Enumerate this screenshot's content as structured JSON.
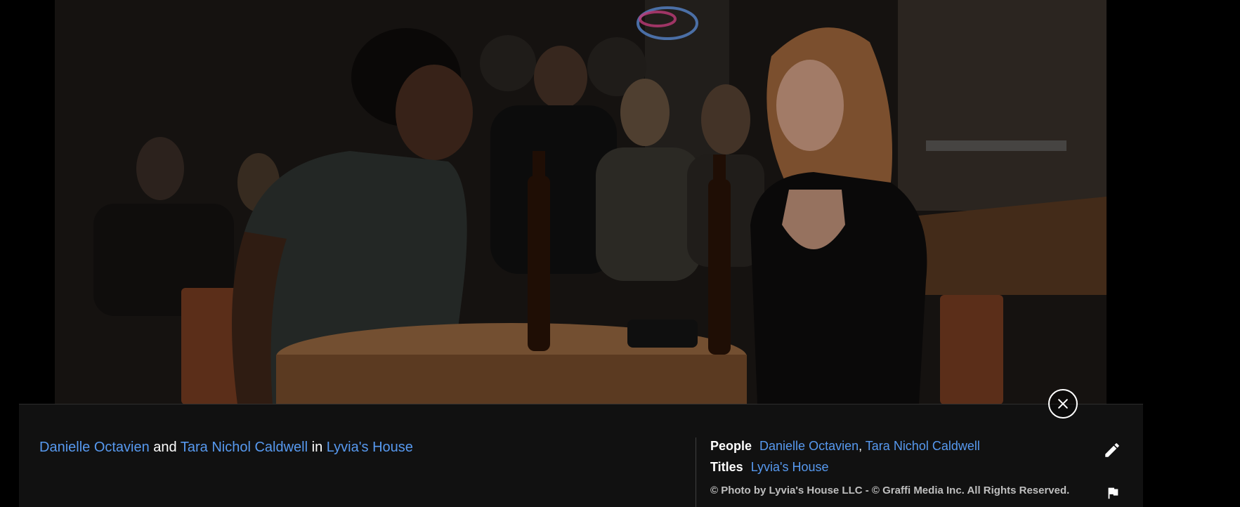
{
  "caption": {
    "person1": "Danielle Octavien",
    "and_text": " and ",
    "person2": "Tara Nichol Caldwell",
    "in_text": " in ",
    "title": "Lyvia's House"
  },
  "people": {
    "label": "People",
    "items": [
      "Danielle Octavien",
      "Tara Nichol Caldwell"
    ],
    "separator": ", "
  },
  "titles": {
    "label": "Titles",
    "items": [
      "Lyvia's House"
    ]
  },
  "copyright": "© Photo by Lyvia's House LLC - © Graffi Media Inc. All Rights Reserved.",
  "icons": {
    "close": "close-icon",
    "edit": "pencil-icon",
    "flag": "flag-icon"
  },
  "colors": {
    "link": "#5799ef",
    "panel": "#121212",
    "text": "#ffffff"
  }
}
